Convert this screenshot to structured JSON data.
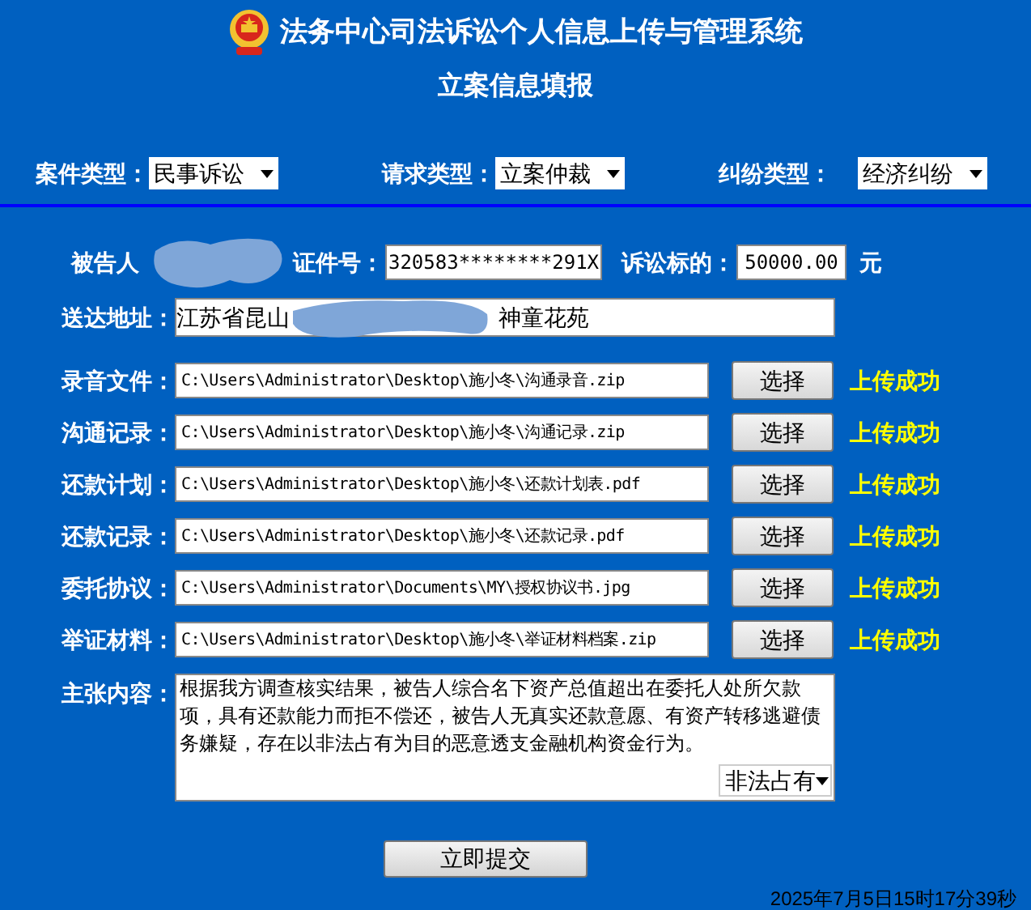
{
  "header": {
    "title": "法务中心司法诉讼个人信息上传与管理系统",
    "subtitle": "立案信息填报"
  },
  "filters": [
    {
      "label": "案件类型：",
      "value": "民事诉讼"
    },
    {
      "label": "请求类型：",
      "value": "立案仲裁"
    },
    {
      "label": "纠纷类型：",
      "value": "经济纠纷"
    }
  ],
  "party": {
    "defendant_label": "被告人",
    "id_label": "证件号：",
    "id_value": "320583********291X",
    "amount_label": "诉讼标的：",
    "amount_value": "50000.00",
    "amount_unit": "元"
  },
  "address": {
    "label": "送达地址：",
    "value_start": "江苏省昆山",
    "value_end": "神童花苑"
  },
  "uploads": [
    {
      "label": "录音文件：",
      "path": "C:\\Users\\Administrator\\Desktop\\施小冬\\沟通录音.zip",
      "button": "选择",
      "status": "上传成功"
    },
    {
      "label": "沟通记录：",
      "path": "C:\\Users\\Administrator\\Desktop\\施小冬\\沟通记录.zip",
      "button": "选择",
      "status": "上传成功"
    },
    {
      "label": "还款计划：",
      "path": "C:\\Users\\Administrator\\Desktop\\施小冬\\还款计划表.pdf",
      "button": "选择",
      "status": "上传成功"
    },
    {
      "label": "还款记录：",
      "path": "C:\\Users\\Administrator\\Desktop\\施小冬\\还款记录.pdf",
      "button": "选择",
      "status": "上传成功"
    },
    {
      "label": "委托协议：",
      "path": "C:\\Users\\Administrator\\Documents\\MY\\授权协议书.jpg",
      "button": "选择",
      "status": "上传成功"
    },
    {
      "label": "举证材料：",
      "path": "C:\\Users\\Administrator\\Desktop\\施小冬\\举证材料档案.zip",
      "button": "选择",
      "status": "上传成功"
    }
  ],
  "claim": {
    "label": "主张内容：",
    "text": "根据我方调查核实结果，被告人综合名下资产总值超出在委托人处所欠款项，具有还款能力而拒不偿还，被告人无真实还款意愿、有资产转移逃避债务嫌疑，存在以非法占有为目的恶意透支金融机构资金行为。",
    "category": "非法占有"
  },
  "submit": "立即提交",
  "timestamp": "2025年7月5日15时17分39秒"
}
